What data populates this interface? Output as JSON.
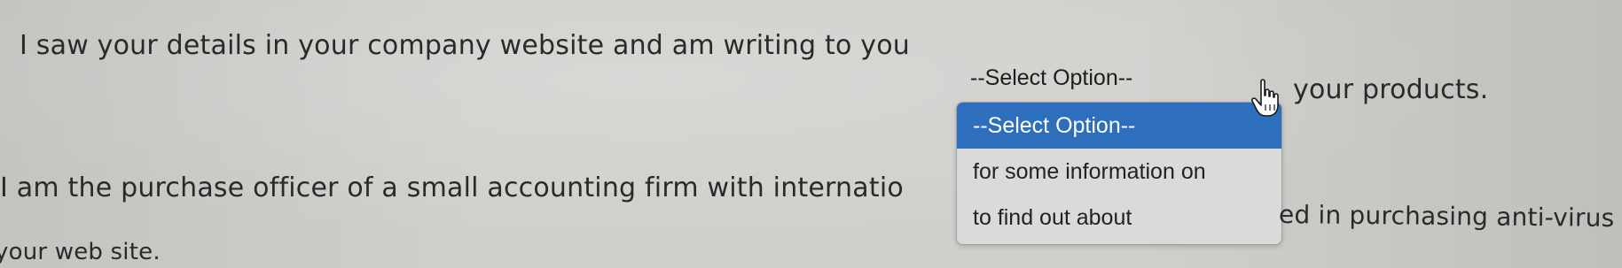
{
  "text": {
    "line1": "I saw your details in your company website and am writing to you",
    "line1_tail": "your products.",
    "line2": "I am the purchase officer of a small accounting firm with internatio",
    "line2_tail": "ed in purchasing anti-virus",
    "line3": "your web site."
  },
  "select": {
    "current_value": "--Select Option--",
    "options": [
      "--Select Option--",
      "for some information on",
      "to find out about"
    ],
    "selected_index": 0
  },
  "colors": {
    "background": "#cfd0cc",
    "text": "#2a2a2a",
    "highlight": "#2e6fbd",
    "dropdown_bg": "#d9dbd8"
  },
  "icons": {
    "cursor": "hand-pointer-icon"
  }
}
